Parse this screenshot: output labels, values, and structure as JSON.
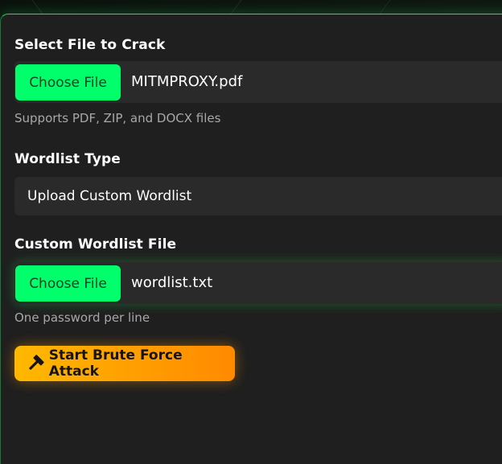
{
  "file_section": {
    "label": "Select File to Crack",
    "choose_button": "Choose File",
    "file_name": "MITMPROXY.pdf",
    "helper": "Supports PDF, ZIP, and DOCX files"
  },
  "wordlist_section": {
    "label": "Wordlist Type",
    "selected": "Upload Custom Wordlist"
  },
  "custom_wordlist_section": {
    "label": "Custom Wordlist File",
    "choose_button": "Choose File",
    "file_name": "wordlist.txt",
    "helper": "One password per line"
  },
  "attack_button": {
    "icon": "hammer-icon",
    "label": "Start Brute Force Attack"
  },
  "colors": {
    "accent_green": "#00ff6a",
    "accent_orange": "#ff9c00",
    "panel_bg": "#1f1f1f",
    "field_bg": "#2a2a2a"
  }
}
